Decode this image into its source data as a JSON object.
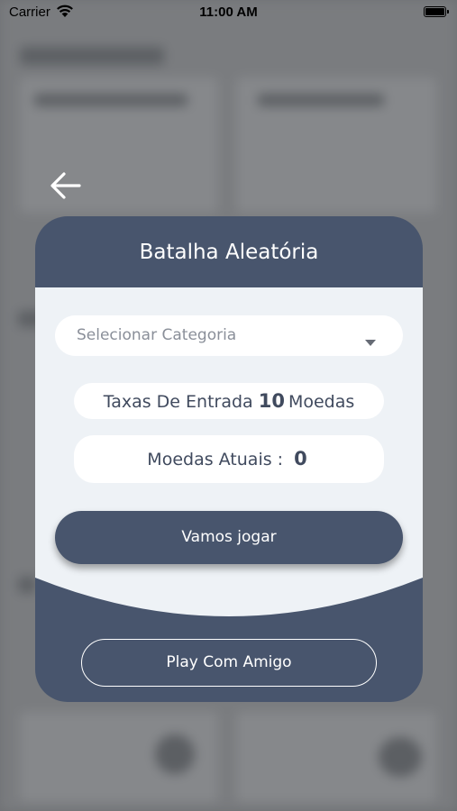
{
  "status_bar": {
    "carrier": "Carrier",
    "time": "11:00 AM"
  },
  "modal": {
    "title": "Batalha Aleatória",
    "category_select": {
      "placeholder": "Selecionar Categoria"
    },
    "entry_fee": {
      "label": "Taxas De Entrada",
      "amount": "10",
      "unit": "Moedas"
    },
    "current_coins": {
      "label": "Moedas Atuais :",
      "amount": "0"
    },
    "play_button": "Vamos jogar",
    "friend_button": "Play Com Amigo"
  },
  "colors": {
    "primary": "#48556d",
    "panel_light": "#eef2f6",
    "overlay": "#6f7174",
    "text_dark": "#404a5e"
  },
  "icons": [
    "wifi-icon",
    "battery-icon",
    "back-arrow-icon",
    "dropdown-caret-icon"
  ]
}
